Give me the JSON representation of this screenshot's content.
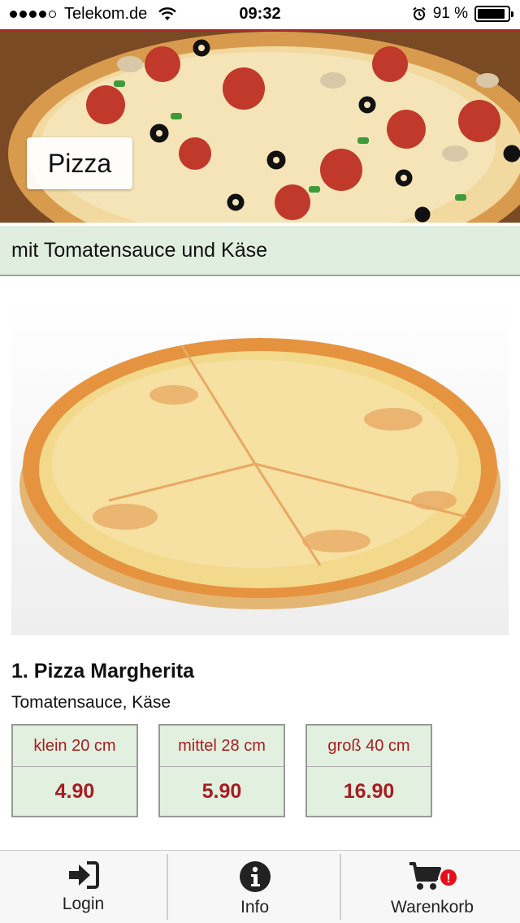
{
  "status_bar": {
    "carrier": "Telekom.de",
    "time": "09:32",
    "battery": "91 %",
    "battery_level": 0.91
  },
  "hero": {
    "category_label": "Pizza"
  },
  "subheader": {
    "text": "mit Tomatensauce und Käse"
  },
  "product": {
    "title": "1. Pizza Margherita",
    "description": "Tomatensauce, Käse",
    "sizes": [
      {
        "label": "klein 20 cm",
        "price": "4.90"
      },
      {
        "label": "mittel 28 cm",
        "price": "5.90"
      },
      {
        "label": "groß 40 cm",
        "price": "16.90"
      }
    ]
  },
  "tabbar": {
    "items": [
      {
        "label": "Login",
        "icon": "login-icon"
      },
      {
        "label": "Info",
        "icon": "info-icon"
      },
      {
        "label": "Warenkorb",
        "icon": "cart-icon",
        "badge": "!"
      }
    ]
  },
  "colors": {
    "accent_red": "#a81c22",
    "header_line": "#a52a2a",
    "light_green": "#e0eedf"
  }
}
